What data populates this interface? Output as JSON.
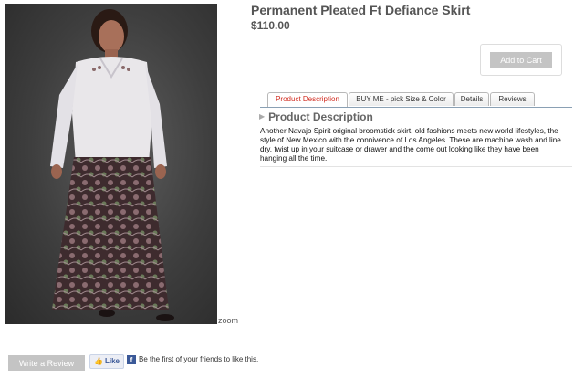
{
  "product": {
    "title": "Permanent Pleated Ft Defiance Skirt",
    "price": "$110.00",
    "add_to_cart_label": "Add to Cart",
    "zoom_label": "zoom"
  },
  "tabs": [
    {
      "label": "Product Description",
      "active": true
    },
    {
      "label": "BUY ME - pick Size & Color",
      "active": false
    },
    {
      "label": "Details",
      "active": false
    },
    {
      "label": "Reviews",
      "active": false
    }
  ],
  "description": {
    "heading": "Product Description",
    "body": "Another Navajo Spirit original broomstick skirt, old fashions meets new world lifestyles, the style of New Mexico with the connivence of Los Angeles. These are machine wash and line dry. twist up in your suitcase or drawer and the come out looking like they have been hanging all the time."
  },
  "footer": {
    "write_review_label": "Write a Review",
    "like_label": "Like",
    "social_text": "Be the first of your friends to like this."
  },
  "colors": {
    "active_tab": "#d12b1f",
    "button_gray": "#c4c4c4",
    "facebook_blue": "#3b5998"
  },
  "icons": [
    "thumbs-up-icon",
    "facebook-icon",
    "triangle-right-icon"
  ]
}
